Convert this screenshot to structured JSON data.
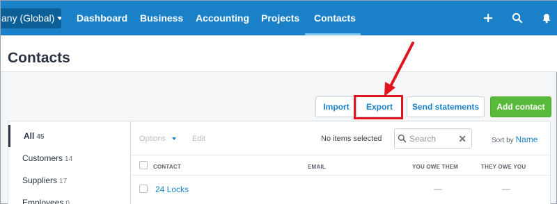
{
  "nav": {
    "org_label": "any (Global)",
    "items": [
      {
        "label": "Dashboard"
      },
      {
        "label": "Business"
      },
      {
        "label": "Accounting"
      },
      {
        "label": "Projects"
      },
      {
        "label": "Contacts"
      }
    ],
    "active": "Contacts",
    "icons": [
      "plus-icon",
      "search-icon",
      "bell-icon"
    ]
  },
  "page": {
    "title": "Contacts"
  },
  "actions": {
    "import_label": "Import",
    "export_label": "Export",
    "send_statements_label": "Send statements",
    "add_contact_label": "Add contact"
  },
  "sidebar": {
    "items": [
      {
        "label": "All",
        "count": "45"
      },
      {
        "label": "Customers",
        "count": "14"
      },
      {
        "label": "Suppliers",
        "count": "17"
      },
      {
        "label": "Employees",
        "count": "0"
      }
    ]
  },
  "toolbar": {
    "options_label": "Options",
    "edit_label": "Edit",
    "selection_status": "No items selected",
    "search_placeholder": "Search",
    "sort_by_label": "Sort by",
    "sort_by_value": "Name"
  },
  "table": {
    "columns": [
      "CONTACT",
      "EMAIL",
      "YOU OWE THEM",
      "THEY OWE YOU"
    ],
    "rows": [
      {
        "contact": "24 Locks",
        "email": "",
        "you_owe_them": "—",
        "they_owe_you": "—"
      }
    ]
  },
  "colors": {
    "nav_bg": "#1a81c9",
    "accent_link": "#1a81c9",
    "primary_button": "#59b93a",
    "highlight": "#e0131f"
  }
}
